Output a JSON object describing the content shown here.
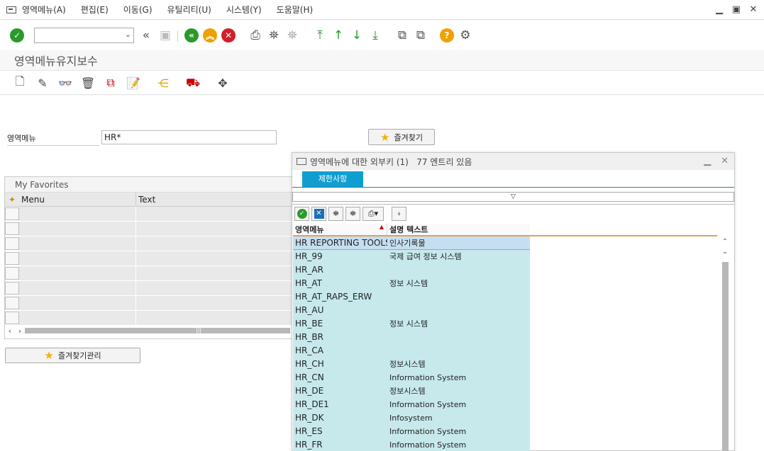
{
  "menubar": {
    "items": [
      "영역메뉴(A)",
      "편집(E)",
      "이동(G)",
      "유틸리티(U)",
      "시스템(Y)",
      "도움말(H)"
    ]
  },
  "toolbar": {
    "command_value": ""
  },
  "page_title": "영역메뉴유지보수",
  "form": {
    "menu_label": "영역메뉴",
    "menu_value": "HR*",
    "favorites_button": "즐겨찾기"
  },
  "favorites": {
    "title": "My Favorites",
    "col_menu": "Menu",
    "col_text": "Text",
    "manage_button": "즐겨찾기관리"
  },
  "popup": {
    "title": "영역메뉴에 대한 외부키 (1)   77 엔트리 있음",
    "tab": "제한사항",
    "col_menu": "영역메뉴",
    "col_desc": "설명 텍스트",
    "rows": [
      {
        "menu": "HR REPORTING TOOLS",
        "desc": "인사기록물"
      },
      {
        "menu": "HR_99",
        "desc": "국제 급여 정보 시스템"
      },
      {
        "menu": "HR_AR",
        "desc": ""
      },
      {
        "menu": "HR_AT",
        "desc": "정보 시스템"
      },
      {
        "menu": "HR_AT_RAPS_ERW",
        "desc": ""
      },
      {
        "menu": "HR_AU",
        "desc": ""
      },
      {
        "menu": "HR_BE",
        "desc": "정보 시스템"
      },
      {
        "menu": "HR_BR",
        "desc": ""
      },
      {
        "menu": "HR_CA",
        "desc": ""
      },
      {
        "menu": "HR_CH",
        "desc": "정보시스템"
      },
      {
        "menu": "HR_CN",
        "desc": "Information System"
      },
      {
        "menu": "HR_DE",
        "desc": "정보시스템"
      },
      {
        "menu": "HR_DE1",
        "desc": "Information System"
      },
      {
        "menu": "HR_DK",
        "desc": "Infosystem"
      },
      {
        "menu": "HR_ES",
        "desc": "Information System"
      },
      {
        "menu": "HR_FR",
        "desc": "Information System"
      }
    ]
  },
  "colors": {
    "ok_green": "#2a9a2a",
    "nav_green": "#2a9a2a",
    "nav_orange": "#f0a000",
    "cancel_red": "#d0202a",
    "tab_blue": "#109ed1",
    "row_bg": "#c7e9ec"
  }
}
